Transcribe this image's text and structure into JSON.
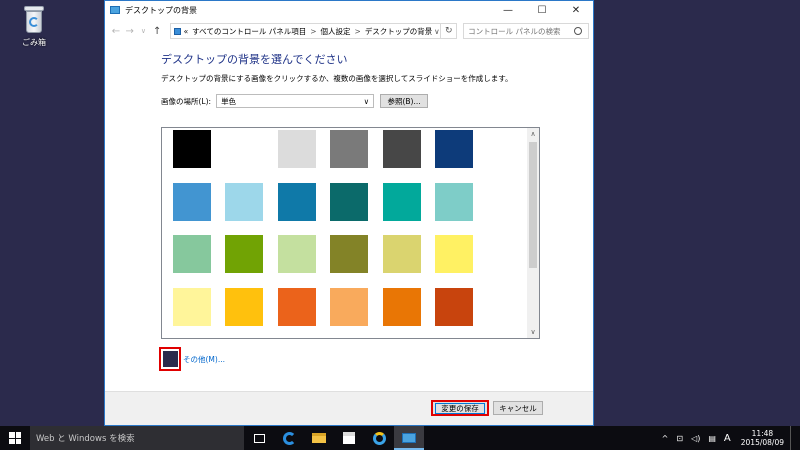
{
  "desktop": {
    "recycle_bin_label": "ごみ箱",
    "background_color": "#2b2a4c"
  },
  "window": {
    "title": "デスクトップの背景",
    "minimize": "—",
    "maximize": "☐",
    "close": "✕",
    "address": {
      "prefix": "«",
      "crumbs": [
        "すべてのコントロール パネル項目",
        "個人設定",
        "デスクトップの背景"
      ],
      "separator": ">",
      "dropdown": "∨",
      "refresh": "↻"
    },
    "search_placeholder": "コントロール パネルの検索",
    "heading": "デスクトップの背景を選んでください",
    "description": "デスクトップの背景にする画像をクリックするか、複数の画像を選択してスライドショーを作成します。",
    "location_label": "画像の場所(L):",
    "location_value": "単色",
    "location_arrow": "∨",
    "browse_label": "参照(B)...",
    "colors": [
      [
        "#000000",
        "#ffffff",
        "#dcdcdc",
        "#7a7a7a",
        "#474747",
        "#0d3b7a"
      ],
      [
        "#4295d1",
        "#9dd7ea",
        "#0f79a8",
        "#0b6a6a",
        "#02a99b",
        "#7ecdc8"
      ],
      [
        "#86c89d",
        "#71a304",
        "#c4e09f",
        "#838327",
        "#dad46f",
        "#fff163"
      ],
      [
        "#fff59a",
        "#ffc10d",
        "#eb631b",
        "#f9aa5c",
        "#e97605",
        "#c8440d"
      ]
    ],
    "scroll_up": "∧",
    "scroll_down": "∨",
    "other_link": "その他(M)...",
    "other_color": "#2b2a4c",
    "save_label": "変更の保存",
    "cancel_label": "キャンセル"
  },
  "taskbar": {
    "search_placeholder": "Web と Windows を検索",
    "tray": {
      "chevron": "^",
      "network": "⊡",
      "volume": "◁)",
      "notifications": "▤",
      "ime": "A"
    },
    "time": "11:48",
    "date": "2015/08/09"
  }
}
